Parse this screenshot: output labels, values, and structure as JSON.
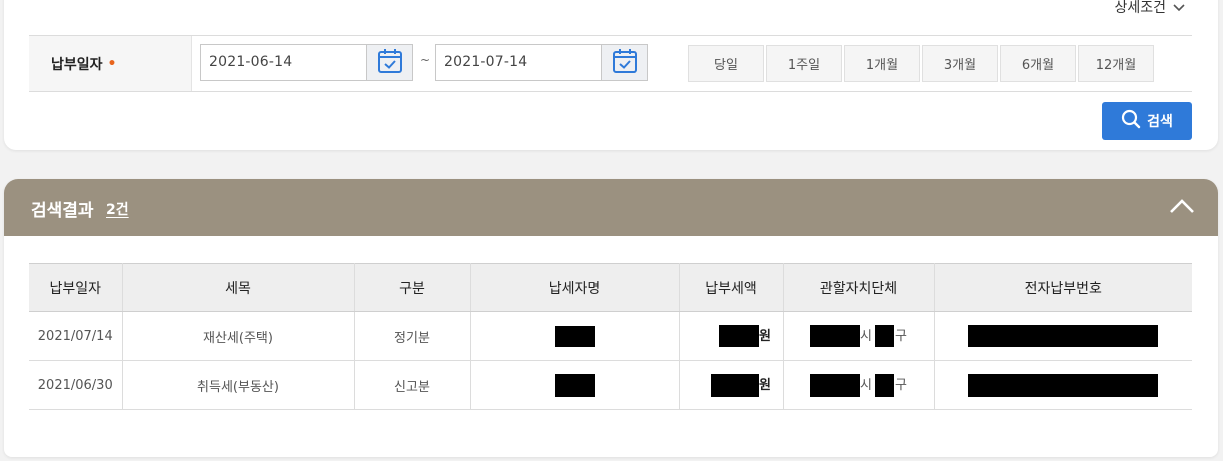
{
  "search": {
    "detail_toggle": "상세조건",
    "date_label": "납부일자",
    "required_mark": "•",
    "date_from": "2021-06-14",
    "date_sep": "~",
    "date_to": "2021-07-14",
    "periods": [
      "당일",
      "1주일",
      "1개월",
      "3개월",
      "6개월",
      "12개월"
    ],
    "search_button": "검색"
  },
  "results": {
    "title": "검색결과",
    "count": "2건",
    "columns": [
      "납부일자",
      "세목",
      "구분",
      "납세자명",
      "납부세액",
      "관할자치단체",
      "전자납부번호"
    ],
    "rows": [
      {
        "date": "2021/07/14",
        "tax_item": "재산세(주택)",
        "type": "정기분",
        "amount_suffix": "원",
        "region_si": "시",
        "region_gu": "구"
      },
      {
        "date": "2021/06/30",
        "tax_item": "취득세(부동산)",
        "type": "신고분",
        "amount_suffix": "원",
        "region_si": "시",
        "region_gu": "구"
      }
    ]
  },
  "colors": {
    "header_bg": "#9b9180",
    "accent": "#2f7ad9",
    "required": "#e8651d"
  }
}
